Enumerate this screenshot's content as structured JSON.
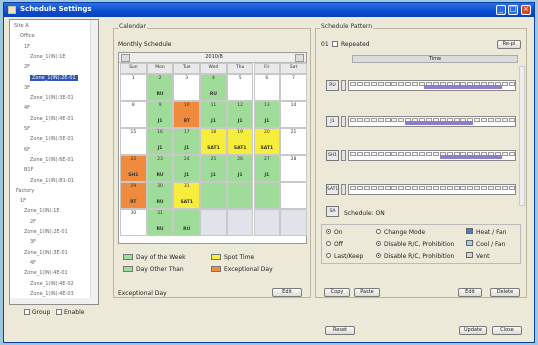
{
  "window": {
    "title": "Schedule Settings"
  },
  "tree": {
    "items": [
      {
        "label": "Site A"
      },
      {
        "label": "Office"
      },
      {
        "label": "1F"
      },
      {
        "label": "Zone_1(IN):1E"
      },
      {
        "label": "2F"
      },
      {
        "label": "Zone_1(IN):2E-01"
      },
      {
        "label": "3F"
      },
      {
        "label": "Zone_1(IN):3E-01"
      },
      {
        "label": "4F"
      },
      {
        "label": "Zone_1(IN):4E-01"
      },
      {
        "label": "5F"
      },
      {
        "label": "Zone_1(IN):5E-01"
      },
      {
        "label": "6F"
      },
      {
        "label": "Zone_1(IN):6E-01"
      },
      {
        "label": "B1F"
      },
      {
        "label": "Zone_1(IN):B1-01"
      },
      {
        "label": "Factory"
      },
      {
        "label": "1F"
      },
      {
        "label": "Zone_1(IN):1E"
      },
      {
        "label": "2F"
      },
      {
        "label": "Zone_1(IN):2E-01"
      },
      {
        "label": "3F"
      },
      {
        "label": "Zone_1(IN):3E-01"
      },
      {
        "label": "4F"
      },
      {
        "label": "Zone_1(IN):4E-01"
      },
      {
        "label": "Zone_1(IN):4E-02"
      },
      {
        "label": "Zone_1(IN):4E-03"
      }
    ],
    "group_label": "Group",
    "enable_label": "Enable"
  },
  "calendar": {
    "section_label": "Calendar",
    "monthly_label": "Monthly Schedule",
    "month_title": "2010/8",
    "days": [
      "Sun",
      "Mon",
      "Tue",
      "Wed",
      "Thu",
      "Fri",
      "Sat"
    ],
    "weeks": [
      [
        [
          "1",
          "wh",
          ""
        ],
        [
          "2",
          "g",
          "RU"
        ],
        [
          "3",
          "wh",
          ""
        ],
        [
          "4",
          "g",
          "RU"
        ],
        [
          "5",
          "wh",
          ""
        ],
        [
          "6",
          "wh",
          ""
        ],
        [
          "7",
          "wh",
          ""
        ]
      ],
      [
        [
          "8",
          "wh",
          ""
        ],
        [
          "9",
          "g",
          "J1"
        ],
        [
          "10",
          "o",
          "RT"
        ],
        [
          "11",
          "g",
          "J1"
        ],
        [
          "12",
          "g",
          "J1"
        ],
        [
          "13",
          "g",
          "J1"
        ],
        [
          "14",
          "wh",
          ""
        ]
      ],
      [
        [
          "15",
          "wh",
          ""
        ],
        [
          "16",
          "g",
          "J1"
        ],
        [
          "17",
          "g",
          "J1"
        ],
        [
          "18",
          "y",
          "SAT1"
        ],
        [
          "19",
          "y",
          "SAT1"
        ],
        [
          "20",
          "y",
          "SAT1"
        ],
        [
          "21",
          "wh",
          ""
        ]
      ],
      [
        [
          "22",
          "o",
          "SH1"
        ],
        [
          "23",
          "g",
          "RU"
        ],
        [
          "24",
          "g",
          "J1"
        ],
        [
          "25",
          "g",
          "J1"
        ],
        [
          "26",
          "g",
          "J1"
        ],
        [
          "27",
          "g",
          "J1"
        ],
        [
          "28",
          "wh",
          ""
        ]
      ],
      [
        [
          "29",
          "o",
          "RT"
        ],
        [
          "30",
          "g",
          "RU"
        ],
        [
          "31",
          "y",
          "SAT1"
        ],
        [
          "",
          "g",
          ""
        ],
        [
          "",
          "g",
          ""
        ],
        [
          "",
          "g",
          ""
        ],
        [
          "",
          "wh",
          ""
        ]
      ],
      [
        [
          "30",
          "wh",
          ""
        ],
        [
          "31",
          "g",
          "RU"
        ],
        [
          "",
          "g",
          "RU"
        ],
        [
          "",
          "gr",
          ""
        ],
        [
          "",
          "gr",
          ""
        ],
        [
          "",
          "gr",
          ""
        ],
        [
          "",
          "gr",
          ""
        ]
      ]
    ],
    "legend": [
      {
        "label": "Day of the Week",
        "color": "#9fdc9a"
      },
      {
        "label": "Spot Time",
        "color": "#f7ee3c"
      },
      {
        "label": "Day Other Than",
        "color": "#9fdc9a"
      },
      {
        "label": "Exceptional Day",
        "color": "#f08a3c"
      }
    ],
    "exceptional_label": "Exceptional Day",
    "edit_button": "Edit"
  },
  "schedule": {
    "section_label": "Schedule Pattern",
    "pattern_id": "01",
    "repeat_label": "Repeated",
    "add_button": "Re-pl",
    "column_header": "Time",
    "rows": [
      {
        "code": "RU",
        "fill_from": 0.45,
        "fill_to": 0.92
      },
      {
        "code": "J1",
        "fill_from": 0.34,
        "fill_to": 0.75
      },
      {
        "code": "SH1",
        "fill_from": 0.55,
        "fill_to": 0.92
      },
      {
        "code": "SAT1",
        "fill_from": 0.0,
        "fill_to": 0.0
      }
    ],
    "schedule_row_btn": "SA",
    "schedule_label": "Schedule: ON",
    "options": {
      "r1": "On",
      "r2": "Off",
      "r3": "Last/Keep",
      "m1": "Change Mode",
      "m2": "Disable R/C, Prohibition",
      "m3": "Disable R/C, Prohibition",
      "c1": "Heat / Fan",
      "c2": "Cool / Fan",
      "c3": "Vent"
    },
    "copy_button": "Copy",
    "paste_button": "Paste",
    "edit_button": "Edit",
    "delete_button": "Delete"
  },
  "footer": {
    "reset_button": "Reset",
    "update_button": "Update",
    "close_button": "Close"
  },
  "colors": {
    "accent": "#2f55b5",
    "green": "#9fdc9a",
    "yellow": "#f7ee3c",
    "orange": "#f08a3c",
    "purple": "#8d7ec8"
  }
}
